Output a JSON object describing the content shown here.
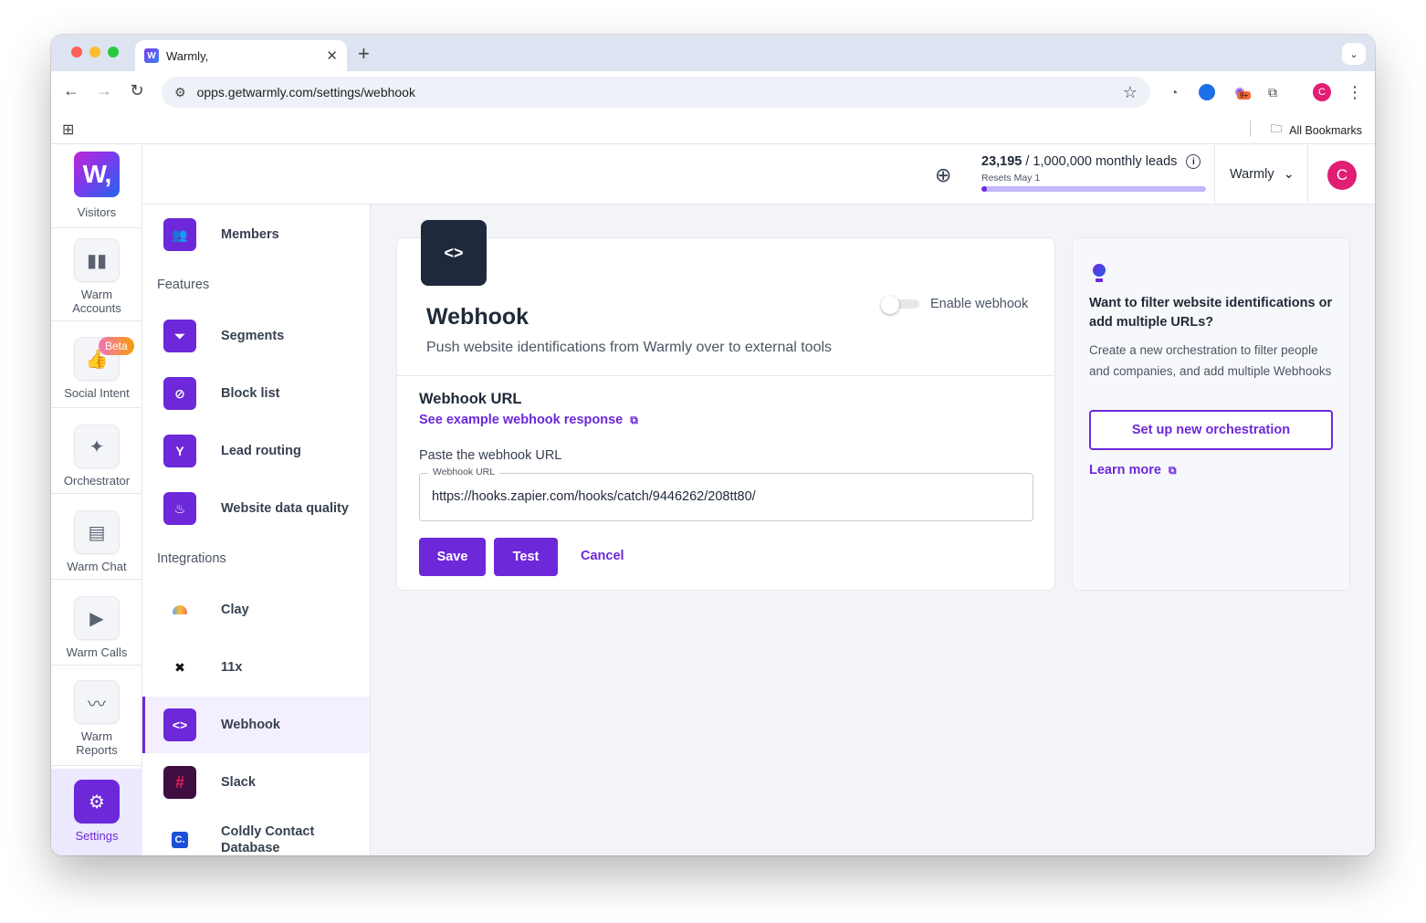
{
  "browser": {
    "tab_title": "Warmly,",
    "tab_favicon": "W",
    "url": "opps.getwarmly.com/settings/webhook",
    "all_bookmarks": "All Bookmarks",
    "profile_initial": "C",
    "ext_badge": "9+"
  },
  "app": {
    "logo_text": "W,",
    "nav": [
      {
        "label": "Visitors"
      },
      {
        "label": "Warm Accounts"
      },
      {
        "label": "Social Intent",
        "badge": "Beta"
      },
      {
        "label": "Orchestrator"
      },
      {
        "label": "Warm Chat"
      },
      {
        "label": "Warm Calls"
      },
      {
        "label": "Warm Reports"
      },
      {
        "label": "Settings"
      }
    ],
    "topbar": {
      "leads_used": "23,195",
      "leads_rest": "/ 1,000,000 monthly leads",
      "resets": "Resets May 1",
      "leads_progress": 0.023,
      "workspace": "Warmly",
      "avatar_initial": "C"
    }
  },
  "settings_nav": {
    "items_top": [
      {
        "label": "Members",
        "icon": "members-icon"
      }
    ],
    "features_heading": "Features",
    "features": [
      {
        "label": "Segments",
        "icon": "filter-icon"
      },
      {
        "label": "Block list",
        "icon": "block-icon"
      },
      {
        "label": "Lead routing",
        "icon": "routing-icon"
      },
      {
        "label": "Website data quality",
        "icon": "flame-icon"
      }
    ],
    "integrations_heading": "Integrations",
    "integrations": [
      {
        "label": "Clay",
        "icon": "clay-icon"
      },
      {
        "label": "11x",
        "icon": "11x-icon"
      },
      {
        "label": "Webhook",
        "icon": "code-icon",
        "active": true
      },
      {
        "label": "Slack",
        "icon": "slack-icon"
      },
      {
        "label": "Coldly Contact Database",
        "icon": "coldly-icon"
      }
    ]
  },
  "webhook": {
    "badge": "<>",
    "title": "Webhook",
    "subtitle": "Push website identifications from Warmly over to external tools",
    "toggle_label": "Enable webhook",
    "toggle_on": false,
    "url_heading": "Webhook URL",
    "example_link": "See example webhook response",
    "paste_label": "Paste the webhook URL",
    "field_legend": "Webhook URL",
    "field_value": "https://hooks.zapier.com/hooks/catch/9446262/208tt80/",
    "save": "Save",
    "test": "Test",
    "cancel": "Cancel"
  },
  "tip": {
    "title": "Want to filter website identifications or add multiple URLs?",
    "text": "Create a new orchestration to filter people and companies, and add multiple Webhooks",
    "button": "Set up new orchestration",
    "learn_more": "Learn more"
  }
}
